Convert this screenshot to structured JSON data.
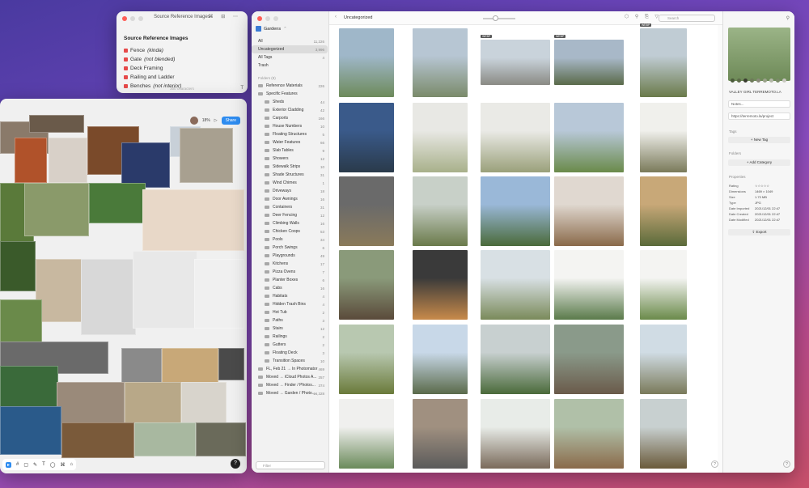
{
  "notes": {
    "title": "Source Reference Images",
    "heading": "Source Reference Images",
    "items": [
      {
        "text": "Fence ",
        "em": "(kinda)"
      },
      {
        "text": "Gate ",
        "em": "(not blended)"
      },
      {
        "text": "Deck Framing",
        "em": ""
      },
      {
        "text": "Railing and Ladder",
        "em": ""
      },
      {
        "text": "Benches ",
        "em": "(not interior)"
      }
    ],
    "char_count": "300 characters"
  },
  "canvas": {
    "zoom": "18%",
    "share_label": "Share",
    "tools": [
      "▸",
      "#",
      "▢",
      "✎",
      "T",
      "◯",
      "⌘",
      "⌂"
    ]
  },
  "sidebar": {
    "library": "Gardens",
    "top": [
      {
        "label": "All",
        "count": "11,226"
      },
      {
        "label": "Uncategorized",
        "count": "3,996"
      },
      {
        "label": "All Tags",
        "count": "4"
      },
      {
        "label": "Trash",
        "count": ""
      }
    ],
    "section": "Folders (8)",
    "folders": [
      {
        "label": "Reference Materials",
        "count": "226"
      },
      {
        "label": "Specific Features",
        "count": ""
      },
      {
        "label": "Sheds",
        "count": "44"
      },
      {
        "label": "Exterior Cladding",
        "count": "42"
      },
      {
        "label": "Carports",
        "count": "166"
      },
      {
        "label": "House Numbers",
        "count": "10"
      },
      {
        "label": "Floating Structures",
        "count": "5"
      },
      {
        "label": "Water Features",
        "count": "66"
      },
      {
        "label": "Slab Tables",
        "count": "9"
      },
      {
        "label": "Showers",
        "count": "12"
      },
      {
        "label": "Sidewalk Strips",
        "count": "10"
      },
      {
        "label": "Shade Structures",
        "count": "31"
      },
      {
        "label": "Wind Chimes",
        "count": "1"
      },
      {
        "label": "Driveways",
        "count": "18"
      },
      {
        "label": "Door Awnings",
        "count": "16"
      },
      {
        "label": "Containers",
        "count": "31"
      },
      {
        "label": "Deer Fencing",
        "count": "12"
      },
      {
        "label": "Climbing Walls",
        "count": "16"
      },
      {
        "label": "Chicken Coops",
        "count": "53"
      },
      {
        "label": "Pools",
        "count": "34"
      },
      {
        "label": "Porch Swings",
        "count": "6"
      },
      {
        "label": "Playgrounds",
        "count": "49"
      },
      {
        "label": "Kitchens",
        "count": "17"
      },
      {
        "label": "Pizza Ovens",
        "count": "7"
      },
      {
        "label": "Planter Boxes",
        "count": "6"
      },
      {
        "label": "Cabs",
        "count": "16"
      },
      {
        "label": "Habitats",
        "count": "4"
      },
      {
        "label": "Hidden Trash Bins",
        "count": "4"
      },
      {
        "label": "Hot Tub",
        "count": "2"
      },
      {
        "label": "Paths",
        "count": "3"
      },
      {
        "label": "Stairs",
        "count": "12"
      },
      {
        "label": "Railings",
        "count": "2"
      },
      {
        "label": "Gutters",
        "count": "2"
      },
      {
        "label": "Floating Deck",
        "count": "3"
      },
      {
        "label": "Transition Spaces",
        "count": "10"
      },
      {
        "label": "FL, Feb 21 → In Photomator",
        "count": "469"
      },
      {
        "label": "Moved → iCloud Photos A...",
        "count": "257"
      },
      {
        "label": "Moved → Finder / Photos...",
        "count": "374"
      },
      {
        "label": "Moved → Garden / Photo...",
        "count": "16,328"
      }
    ],
    "filter_placeholder": "Filter"
  },
  "topbar": {
    "breadcrumb": "Uncategorized",
    "search_placeholder": "Search"
  },
  "grid": {
    "badge_label": "WEBP"
  },
  "inspector": {
    "name": "VALLEY GIRL  TERREMOTO.LA",
    "notes_placeholder": "Notes...",
    "url": "https://terremoto.la/project",
    "tags_heading": "Tags",
    "new_tag": "+ New Tag",
    "folders_heading": "Folders",
    "add_category": "+ Add Category",
    "properties_heading": "Properties",
    "properties": [
      {
        "k": "Rating",
        "v": "☆☆☆☆☆"
      },
      {
        "k": "Dimensions",
        "v": "1469 × 1049"
      },
      {
        "k": "Size",
        "v": "1.73 MB"
      },
      {
        "k": "Type",
        "v": "JPG"
      },
      {
        "k": "Date Imported",
        "v": "2021/12/01 22:47"
      },
      {
        "k": "Date Created",
        "v": "2021/12/01 22:47"
      },
      {
        "k": "Date Modified",
        "v": "2021/12/01 22:47"
      }
    ],
    "export_label": "⇪ Export",
    "swatches": [
      "#4a5a3a",
      "#5c6b48",
      "#3a3d30",
      "#6e7a5a",
      "#8a8a7a",
      "#9aa28a",
      "#b4b8a8",
      "#7a8a68",
      "#c8c8c0"
    ]
  }
}
